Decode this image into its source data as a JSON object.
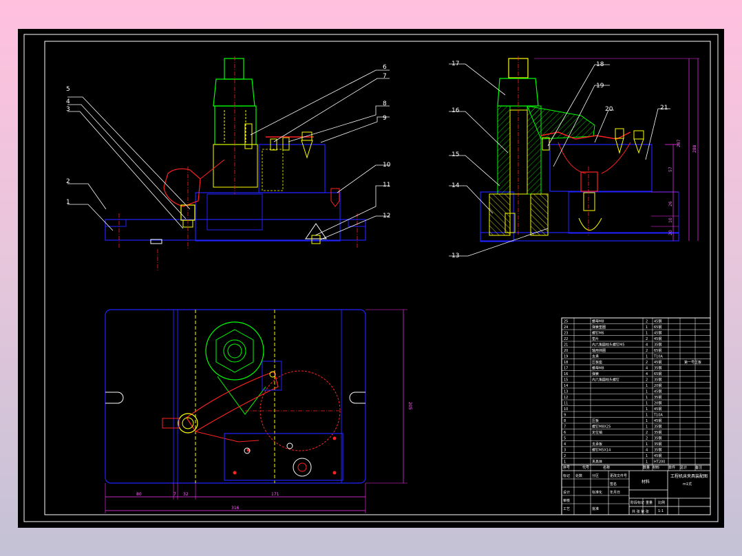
{
  "drawing": {
    "colors": {
      "background": "#000000",
      "outline": "#ffffff",
      "part": "#2222ff",
      "clamp": "#00ff00",
      "spring": "#ffff00",
      "red": "#ff2222",
      "dimension": "#ff33ff"
    },
    "part_labels": [
      "1",
      "2",
      "3",
      "4",
      "5",
      "6",
      "7",
      "8",
      "9",
      "10",
      "11",
      "12",
      "13",
      "14",
      "15",
      "16",
      "17",
      "18",
      "19",
      "20",
      "21"
    ],
    "dimensions": {
      "bottom_80": "80",
      "bottom_7": "7",
      "bottom_32": "32",
      "bottom_171": "171",
      "bottom_316": "316",
      "right_205": "205",
      "side_287": "287",
      "side_288": "288",
      "side_57": "57",
      "side_26": "26",
      "side_10": "10",
      "side_20": "20"
    },
    "title_block": {
      "material": "材料",
      "drawing_title": "工程机床夹具装配图",
      "drawing_subtitle": "m1式",
      "scale": "1:1",
      "sheet_info": "共  张 第  张",
      "change_columns": [
        "标记",
        "处数",
        "分区",
        "更改文件号",
        "签名",
        "年月日"
      ],
      "role_design": "设计",
      "role_check": "审核",
      "role_process": "工艺",
      "role_approve": "批准",
      "standardize": "标准化",
      "stage_mark": "阶段标记",
      "weight": "重量",
      "ratio": "比例",
      "header_columns": [
        "序号",
        "代号",
        "名称",
        "数量",
        "材料",
        "单件",
        "总计",
        "备注"
      ],
      "bom_rows": [
        {
          "no": "25",
          "name": "螺母M8",
          "qty": "2",
          "mat": "45钢",
          "note": ""
        },
        {
          "no": "24",
          "name": "弹簧垫圈",
          "qty": "1",
          "mat": "65钢",
          "note": ""
        },
        {
          "no": "23",
          "name": "螺钉M6",
          "qty": "1",
          "mat": "45钢",
          "note": ""
        },
        {
          "no": "22",
          "name": "垫片",
          "qty": "2",
          "mat": "45钢",
          "note": ""
        },
        {
          "no": "21",
          "name": "内六角圆柱头螺钉M5",
          "qty": "4",
          "mat": "35钢",
          "note": ""
        },
        {
          "no": "20",
          "name": "轴用挡圈",
          "qty": "2",
          "mat": "65钢",
          "note": ""
        },
        {
          "no": "19",
          "name": "支承",
          "qty": "1",
          "mat": "T10A",
          "note": ""
        },
        {
          "no": "18",
          "name": "压板座",
          "qty": "2",
          "mat": "45钢",
          "note": "第一号压板"
        },
        {
          "no": "17",
          "name": "螺母M8",
          "qty": "4",
          "mat": "35钢",
          "note": ""
        },
        {
          "no": "16",
          "name": "弹簧",
          "qty": "4",
          "mat": "65钢",
          "note": ""
        },
        {
          "no": "15",
          "name": "内六角圆柱头螺钉",
          "qty": "2",
          "mat": "35钢",
          "note": ""
        },
        {
          "no": "14",
          "name": "",
          "qty": "1",
          "mat": "20钢",
          "note": ""
        },
        {
          "no": "13",
          "name": "",
          "qty": "1",
          "mat": "45钢",
          "note": ""
        },
        {
          "no": "12",
          "name": "",
          "qty": "1",
          "mat": "35钢",
          "note": ""
        },
        {
          "no": "11",
          "name": "",
          "qty": "1",
          "mat": "20钢",
          "note": ""
        },
        {
          "no": "10",
          "name": "",
          "qty": "1",
          "mat": "45钢",
          "note": ""
        },
        {
          "no": "9",
          "name": "",
          "qty": "1",
          "mat": "T10A",
          "note": ""
        },
        {
          "no": "8",
          "name": "压板",
          "qty": "1",
          "mat": "45钢",
          "note": ""
        },
        {
          "no": "7",
          "name": "螺钉M8X25",
          "qty": "1",
          "mat": "35钢",
          "note": ""
        },
        {
          "no": "6",
          "name": "定位销",
          "qty": "2",
          "mat": "35钢",
          "note": ""
        },
        {
          "no": "5",
          "name": "",
          "qty": "2",
          "mat": "35钢",
          "note": ""
        },
        {
          "no": "4",
          "name": "支承板",
          "qty": "1",
          "mat": "35钢",
          "note": ""
        },
        {
          "no": "3",
          "name": "螺钉M5X14",
          "qty": "4",
          "mat": "35钢",
          "note": ""
        },
        {
          "no": "2",
          "name": "",
          "qty": "1",
          "mat": "45钢",
          "note": ""
        },
        {
          "no": "1",
          "name": "夹具体",
          "qty": "1",
          "mat": "HT200",
          "note": ""
        }
      ]
    }
  }
}
